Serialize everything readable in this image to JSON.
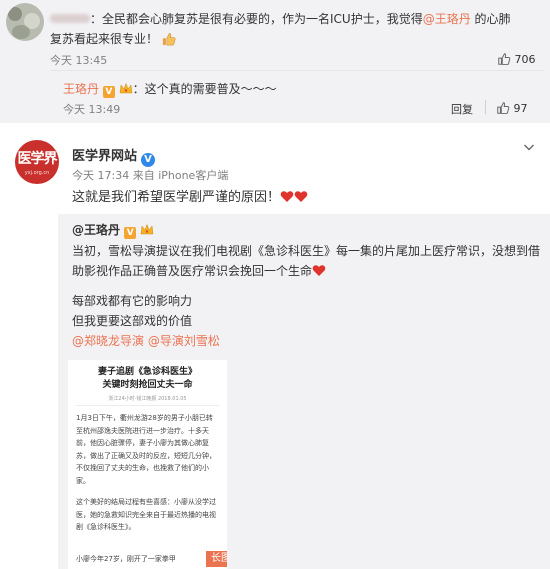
{
  "comment1": {
    "text_prefix": "：全民都会心肺复苏是很有必要的，作为一名ICU护士，我觉得",
    "mention": "@王珞丹",
    "text_suffix": " 的心肺复苏看起来很专业！",
    "time": "今天 13:45",
    "like_count": "706"
  },
  "reply": {
    "author": "王珞丹",
    "text": "：这个真的需要普及～～～",
    "time": "今天 13:49",
    "reply_label": "回复",
    "like_count": "97"
  },
  "post": {
    "logo_text": "医学界",
    "logo_sub": "yxj.org.cn",
    "author": "医学界网站",
    "time": "今天 17:34 来自 iPhone客户端",
    "text": "这就是我们希望医学剧严谨的原因！",
    "repost": {
      "author": "@王珞丹",
      "line1": "当初，雪松导演提议在我们电视剧《急诊科医生》每一集的片尾加上医疗常识，没想到借助影视作品正确普及医疗常识会挽回一个生命",
      "line2": "每部戏都有它的影响力",
      "line3": "但我更要这部戏的价值",
      "mention1": "@郑晓龙导演",
      "mention2": "@导演刘雪松",
      "card": {
        "title1": "妻子追剧《急诊科医生》",
        "title2": "关键时刻抢回丈夫一命",
        "source": "浙江24小时·钱江晚报 2018.01.05",
        "para1": "1月3日下午，衢州龙游28岁的男子小朋已转至杭州邵逸夫医院进行进一步治疗。十多天前，他因心脏骤停，妻子小廖为其做心肺复苏，做出了正确又及时的反应，短短几分钟，不仅挽回了丈夫的生命，也挽救了他们的小家。",
        "para2": "这个美好的结局过程有些喜感：小廖从没学过医，她的急救知识完全来自于最近热播的电视剧《急诊科医生》。",
        "para3": "小廖今年27岁，刚开了一家拳甲",
        "tag": "长图"
      }
    }
  },
  "colors": {
    "link": "#eb7350",
    "gray_bg": "#f2f2f5",
    "logo_red": "#c9302c",
    "verified_blue": "#2f88e8"
  },
  "icons": [
    "thumbs-up-icon",
    "verified-badge-icon",
    "crown-icon",
    "heart-icon",
    "chevron-down-icon"
  ]
}
